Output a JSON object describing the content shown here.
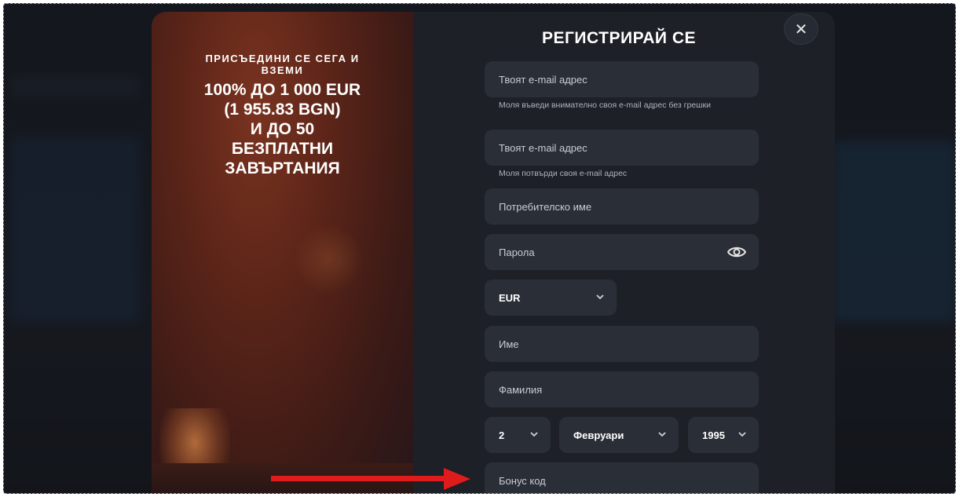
{
  "modal": {
    "promo_sub": "ПРИСЪЕДИНИ СЕ СЕГА И ВЗЕМИ",
    "promo_lines": [
      "100% ДО 1 000 EUR",
      "(1 955.83 BGN)",
      "И ДО 50",
      "БЕЗПЛАТНИ",
      "ЗАВЪРТАНИЯ"
    ],
    "title": "РЕГИСТРИРАЙ СЕ",
    "close_label": "✕"
  },
  "form": {
    "email_placeholder": "Твоят e-mail адрес",
    "email_hint": "Моля въведи внимателно своя e-mail адрес без грешки",
    "email_confirm_placeholder": "Твоят e-mail адрес",
    "email_confirm_hint": "Моля потвърди своя e-mail адрес",
    "username_placeholder": "Потребителско име",
    "password_placeholder": "Парола",
    "currency_value": "EUR",
    "first_name_placeholder": "Име",
    "last_name_placeholder": "Фамилия",
    "birth_day": "2",
    "birth_month": "Февруари",
    "birth_year": "1995",
    "bonus_code_placeholder": "Бонус код"
  },
  "colors": {
    "accent_arrow": "#e01b1b",
    "field_bg": "#2a2e36",
    "modal_bg": "#1d2027"
  },
  "icons": [
    "close-icon",
    "eye-icon",
    "chevron-down-icon",
    "red-arrow-annotation"
  ]
}
